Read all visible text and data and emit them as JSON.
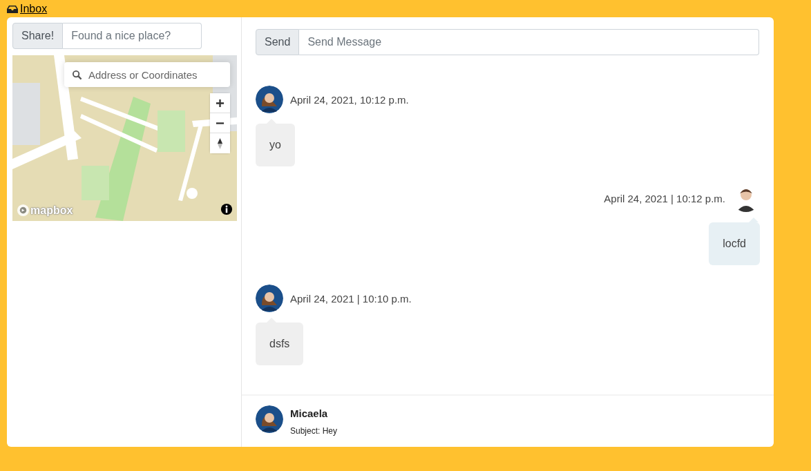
{
  "nav": {
    "link": "Inbox"
  },
  "share": {
    "button": "Share!",
    "placeholder": "Found a nice place?"
  },
  "map": {
    "kind": "picture",
    "search_placeholder": "Address or Coordinates",
    "logo": "mapbox"
  },
  "compose": {
    "button": "Send",
    "placeholder": "Send Message"
  },
  "messages": [
    {
      "kind": "received",
      "time": "April 24, 2021, 10:12 p.m.",
      "text": "yo"
    },
    {
      "kind": "sent",
      "time": "April 24, 2021 | 10:12 p.m.",
      "text": "locfd"
    },
    {
      "kind": "received",
      "time": "April 24, 2021 | 10:10 p.m.",
      "text": "dsfs"
    }
  ],
  "conversation": {
    "name": "Micaela",
    "subject": "Subject: Hey"
  }
}
